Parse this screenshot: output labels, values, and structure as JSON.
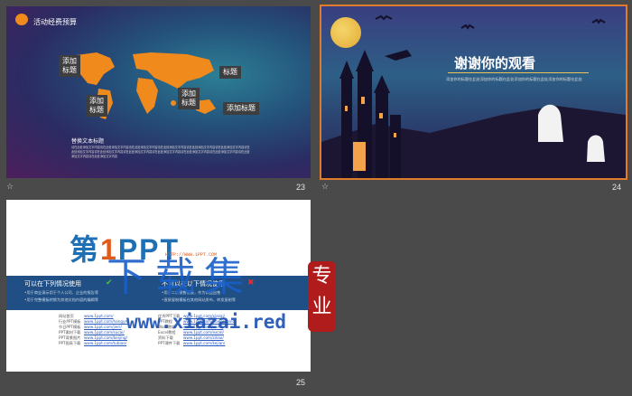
{
  "slides": [
    {
      "number": "23",
      "title": "活动经费预算",
      "labels": [
        "添加\n标题",
        "添加\n标题",
        "添加\n标题",
        "标题",
        "添加标题"
      ],
      "subtitle": "替换文本标题",
      "paragraph": "请在此处添加文字内容请在此处添加文字内容请在此处添加文字内容请在此处添加文字内容请在此处添加文字内容请在此处添加文字内容请在此处添加文字内容请在此处添加文字内容请在此处添加文字内容请在此处添加文字内容请在此处添加文字内容请在此处添加文字内容请在此处添加文字内容请在此处添加文字内容"
    },
    {
      "number": "24",
      "title": "谢谢你的观看",
      "subtitle": "添加你的标题在此处添加你的标题在此处添加你的标题在此处添加你的标题在此处"
    },
    {
      "number": "25",
      "logo_prefix": "第",
      "logo_one": "1",
      "logo_suffix": "PPT",
      "logo_url": "HTTP://WWW.1PPT.COM",
      "allowed_heading": "可以在下列情况使用",
      "allowed_lines": [
        "•用于商业演示用于个人公司、企业的报告等",
        "•用于完整模板转换为其他文档内容的编辑等"
      ],
      "forbidden_heading": "不可以在以下情况使用",
      "forbidden_lines": [
        "•用于二次销售模板，作为商品出售",
        "•直接复制模板在其他网站发布，转发复制等"
      ],
      "col1": [
        "网站首页",
        "行业PPT模板",
        "节日PPT模板",
        "PPT素材下载",
        "PPT背景图片",
        "PPT图表下载"
      ],
      "col2": [
        "www.1ppt.com/",
        "www.1ppt.com/hangye/",
        "www.1ppt.com/jieri/",
        "www.1ppt.com/sucai/",
        "www.1ppt.com/beijing/",
        "www.1ppt.com/tubiao/"
      ],
      "col3": [
        "优秀PPT下载",
        "PPT教程",
        "Word教程",
        "Excel教程",
        "资料下载",
        "PPT课件下载"
      ],
      "col4": [
        "www.1ppt.com/xiazai/",
        "www.1ppt.com/powerpoint/",
        "www.1ppt.com/word/",
        "www.1ppt.com/excel/",
        "www.1ppt.com/ziliao/",
        "www.1ppt.com/kejian/"
      ]
    }
  ],
  "watermark": {
    "big": "下载集",
    "url": "www.xiazai.red",
    "seal": "专业"
  },
  "colors": {
    "accent": "#e07b2a",
    "map": "#f08a1c",
    "bar": "#1f4f84"
  }
}
